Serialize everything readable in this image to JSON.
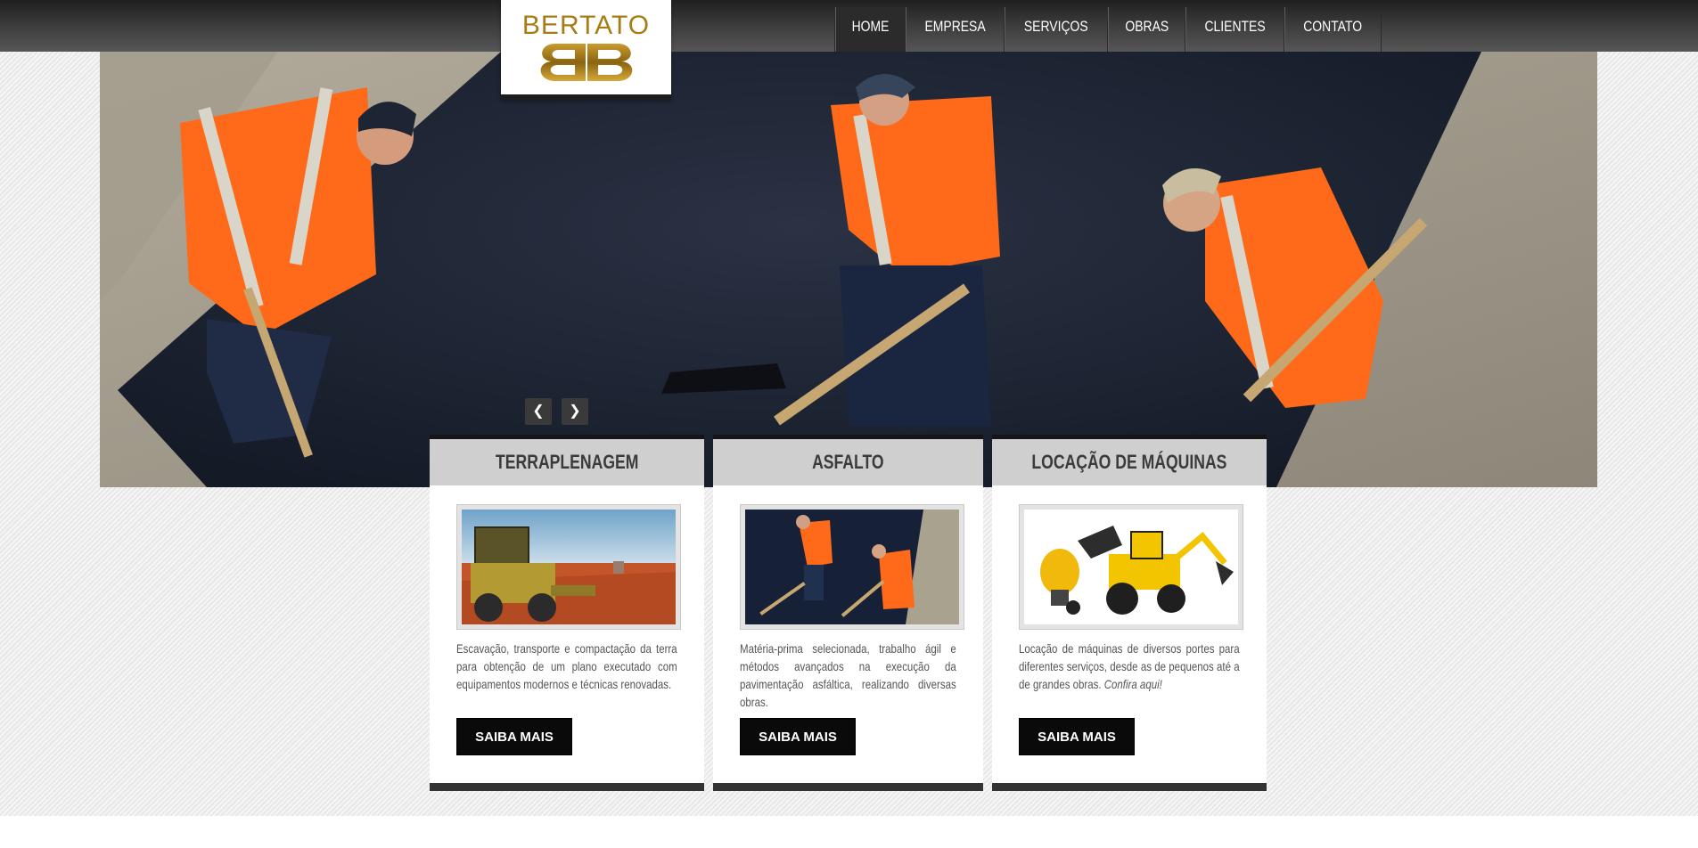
{
  "brand": {
    "name": "BERTATO",
    "logo_icon": "bb-monogram",
    "color": "#a77c14"
  },
  "nav": {
    "items": [
      {
        "label": "HOME",
        "active": true
      },
      {
        "label": "EMPRESA",
        "active": false
      },
      {
        "label": "SERVIÇOS",
        "active": false
      },
      {
        "label": "OBRAS",
        "active": false
      },
      {
        "label": "CLIENTES",
        "active": false
      },
      {
        "label": "CONTATO",
        "active": false
      }
    ]
  },
  "slider": {
    "prev_icon": "chevron-left-icon",
    "next_icon": "chevron-right-icon"
  },
  "cards": [
    {
      "title": "TERRAPLENAGEM",
      "text": "Escavação, transporte e compactação da terra para obtenção de um plano executado com equipamentos modernos e técnicas renovadas.",
      "link_text": "",
      "button": "SAIBA MAIS"
    },
    {
      "title": "ASFALTO",
      "text": "Matéria-prima selecionada, trabalho ágil e métodos avançados na execução da pavimentação asfáltica, realizando diversas obras.",
      "link_text": "",
      "button": "SAIBA MAIS"
    },
    {
      "title": "LOCAÇÃO DE MÁQUINAS",
      "text": "Locação de máquinas de diversos portes para diferentes serviços, desde as de pequenos até a de grandes obras.",
      "link_text": "Confira aqui!",
      "button": "SAIBA MAIS"
    }
  ],
  "colors": {
    "header_dark": "#2b2b2b",
    "button": "#0a0a0a",
    "card_head": "#cfcfcf",
    "safety_orange": "#ff6a1a"
  }
}
